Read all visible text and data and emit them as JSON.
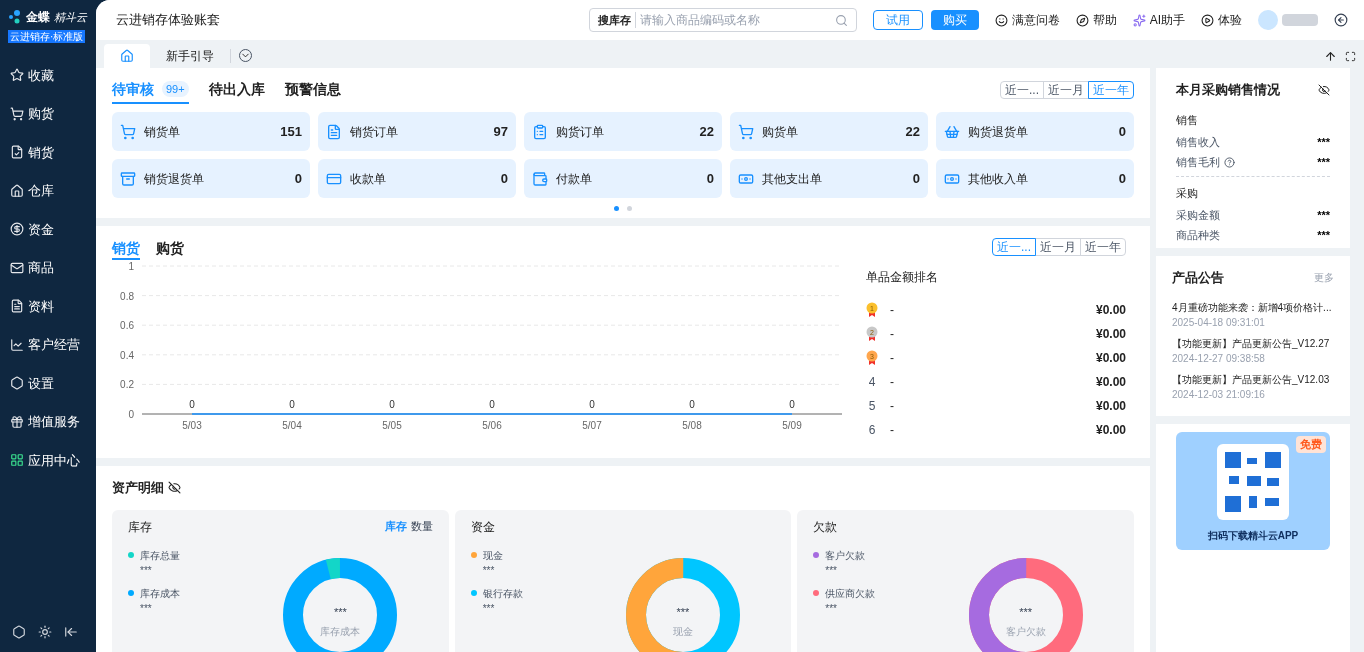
{
  "logo": {
    "brand": "金蝶",
    "product": "精斗云",
    "edition": "云进销存·标准版"
  },
  "header": {
    "account": "云进销存体验账套",
    "search": {
      "scope": "搜库存",
      "placeholder": "请输入商品编码或名称"
    },
    "trial_button": "试用",
    "buy_button": "购买",
    "links": [
      {
        "kind": "survey",
        "label": "满意问卷"
      },
      {
        "kind": "help",
        "label": "帮助"
      },
      {
        "kind": "ai",
        "label": "AI助手"
      },
      {
        "kind": "play",
        "label": "体验"
      }
    ]
  },
  "sidebar": {
    "items": [
      {
        "label": "收藏"
      },
      {
        "label": "购货"
      },
      {
        "label": "销货"
      },
      {
        "label": "仓库"
      },
      {
        "label": "资金"
      },
      {
        "label": "商品"
      },
      {
        "label": "资料"
      },
      {
        "label": "客户经营"
      },
      {
        "label": "设置"
      },
      {
        "label": "增值服务"
      },
      {
        "label": "应用中心"
      }
    ]
  },
  "page_tabs": [
    {
      "kind": "home",
      "selected": true
    },
    {
      "kind": "text",
      "label": "新手引导",
      "selected": false
    }
  ],
  "tasks": {
    "tabs": [
      {
        "label": "待审核",
        "badge": "99+",
        "selected": true
      },
      {
        "label": "待出入库",
        "selected": false
      },
      {
        "label": "预警信息",
        "selected": false
      }
    ],
    "periods": [
      {
        "label": "近一...",
        "selected": false
      },
      {
        "label": "近一月",
        "selected": false
      },
      {
        "label": "近一年",
        "selected": true
      }
    ],
    "cards": [
      {
        "label": "销货单",
        "count": "151"
      },
      {
        "label": "销货订单",
        "count": "97"
      },
      {
        "label": "购货订单",
        "count": "22"
      },
      {
        "label": "购货单",
        "count": "22"
      },
      {
        "label": "购货退货单",
        "count": "0"
      },
      {
        "label": "销货退货单",
        "count": "0"
      },
      {
        "label": "收款单",
        "count": "0"
      },
      {
        "label": "付款单",
        "count": "0"
      },
      {
        "label": "其他支出单",
        "count": "0"
      },
      {
        "label": "其他收入单",
        "count": "0"
      }
    ],
    "pages": [
      {
        "selected": true
      },
      {
        "selected": false
      }
    ]
  },
  "sales_chart": {
    "tabs": [
      {
        "label": "销货",
        "selected": true
      },
      {
        "label": "购货",
        "selected": false
      }
    ],
    "periods": [
      {
        "label": "近一...",
        "selected": true
      },
      {
        "label": "近一月",
        "selected": false
      },
      {
        "label": "近一年",
        "selected": false
      }
    ],
    "chart_data": {
      "type": "line",
      "categories": [
        "5/03",
        "5/04",
        "5/05",
        "5/06",
        "5/07",
        "5/08",
        "5/09"
      ],
      "series": [
        {
          "color": "#1890ff",
          "values": [
            0,
            0,
            0,
            0,
            0,
            0,
            0
          ]
        }
      ],
      "ylim": [
        0,
        1
      ],
      "yticks": [
        0,
        0.2,
        0.4,
        0.6,
        0.8,
        1
      ],
      "grid": true,
      "data_labels": true
    },
    "ranking": {
      "title": "单品金额排名",
      "rows": [
        {
          "rank": "1",
          "kind": "gold",
          "name": "-",
          "amount": "¥0.00"
        },
        {
          "rank": "2",
          "kind": "silver",
          "name": "-",
          "amount": "¥0.00"
        },
        {
          "rank": "3",
          "kind": "bronze",
          "name": "-",
          "amount": "¥0.00"
        },
        {
          "rank": "4",
          "kind": "number",
          "name": "-",
          "amount": "¥0.00"
        },
        {
          "rank": "5",
          "kind": "number",
          "name": "-",
          "amount": "¥0.00"
        },
        {
          "rank": "6",
          "kind": "number",
          "name": "-",
          "amount": "¥0.00"
        }
      ]
    }
  },
  "assets": {
    "title": "资产明细",
    "cards": [
      {
        "title": "库存",
        "toggle": [
          {
            "label": "库存",
            "selected": true
          },
          {
            "label": "数量",
            "selected": false
          }
        ],
        "legend": [
          {
            "label": "库存总量",
            "value": "***",
            "color": "#13d6c8"
          },
          {
            "label": "库存成本",
            "value": "***",
            "color": "#00aaff"
          }
        ],
        "center_value": "***",
        "center_label": "库存成本"
      },
      {
        "title": "资金",
        "legend": [
          {
            "label": "现金",
            "value": "***",
            "color": "#ffa53b"
          },
          {
            "label": "银行存款",
            "value": "***",
            "color": "#00c6ff"
          }
        ],
        "center_value": "***",
        "center_label": "现金"
      },
      {
        "title": "欠款",
        "legend": [
          {
            "label": "客户欠款",
            "value": "***",
            "color": "#a66be0"
          },
          {
            "label": "供应商欠款",
            "value": "***",
            "color": "#ff6b7d"
          }
        ],
        "center_value": "***",
        "center_label": "客户欠款"
      }
    ]
  },
  "summary": {
    "title": "本月采购销售情况",
    "groups": [
      {
        "title": "销售",
        "rows": [
          {
            "label": "销售收入",
            "value": "***",
            "help": false
          },
          {
            "label": "销售毛利",
            "value": "***",
            "help": true
          }
        ]
      },
      {
        "title": "采购",
        "rows": [
          {
            "label": "采购金额",
            "value": "***",
            "help": false
          },
          {
            "label": "商品种类",
            "value": "***",
            "help": false
          }
        ]
      }
    ]
  },
  "announcements": {
    "title": "产品公告",
    "more": "更多",
    "items": [
      {
        "title": "4月重磅功能来袭：新增4项价格计...",
        "date": "2025-04-18 09:31:01"
      },
      {
        "title": "【功能更新】产品更新公告_V12.27",
        "date": "2024-12-27 09:38:58"
      },
      {
        "title": "【功能更新】产品更新公告_V12.03",
        "date": "2024-12-03 21:09:16"
      }
    ]
  },
  "app_promo": {
    "badge": "免费",
    "caption": "扫码下载精斗云APP"
  }
}
